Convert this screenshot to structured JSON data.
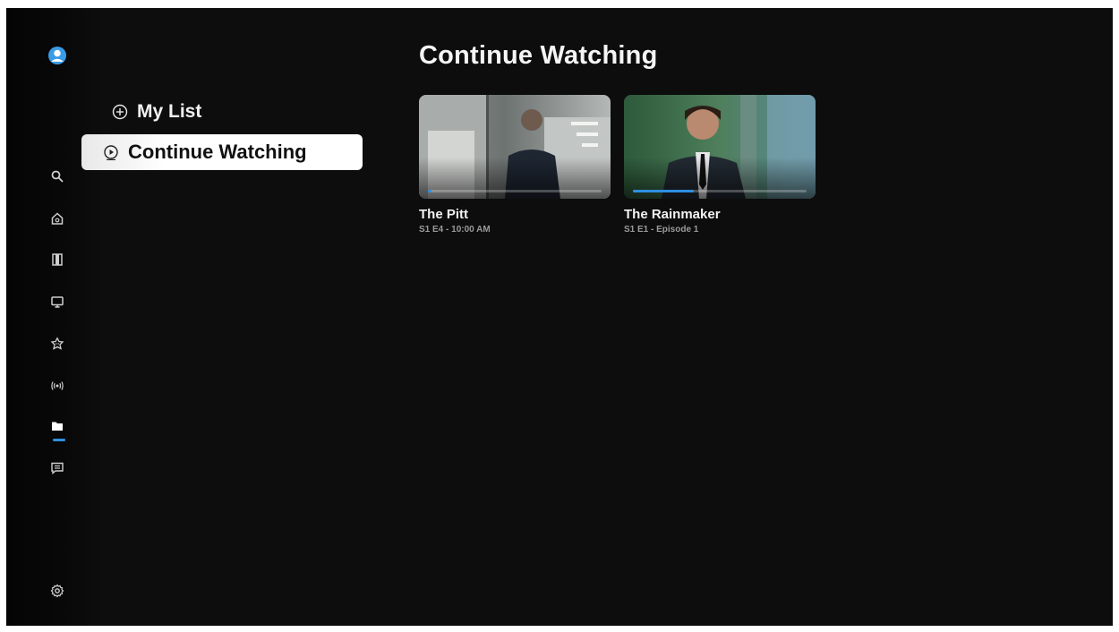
{
  "page": {
    "title": "Continue Watching"
  },
  "colors": {
    "background": "#0d0d0d",
    "accent": "#2e8fe0",
    "selected_bg": "#ffffff"
  },
  "rail": {
    "items": [
      {
        "icon": "profile-avatar-icon"
      },
      {
        "icon": "search-icon"
      },
      {
        "icon": "home-icon"
      },
      {
        "icon": "movies-film-icon"
      },
      {
        "icon": "tv-icon"
      },
      {
        "icon": "kids-icon"
      },
      {
        "icon": "live-broadcast-icon"
      },
      {
        "icon": "library-folder-icon",
        "active": true
      },
      {
        "icon": "chat-feedback-icon"
      },
      {
        "icon": "settings-gear-icon"
      }
    ]
  },
  "submenu": {
    "items": [
      {
        "label": "My List",
        "icon": "plus-circle-icon",
        "selected": false
      },
      {
        "label": "Continue Watching",
        "icon": "play-circle-icon",
        "selected": true
      }
    ]
  },
  "cards": [
    {
      "title": "The Pitt",
      "subtitle": "S1 E4 - 10:00 AM",
      "progress": 0.02
    },
    {
      "title": "The Rainmaker",
      "subtitle": "S1 E1 - Episode 1",
      "progress": 0.35
    }
  ]
}
